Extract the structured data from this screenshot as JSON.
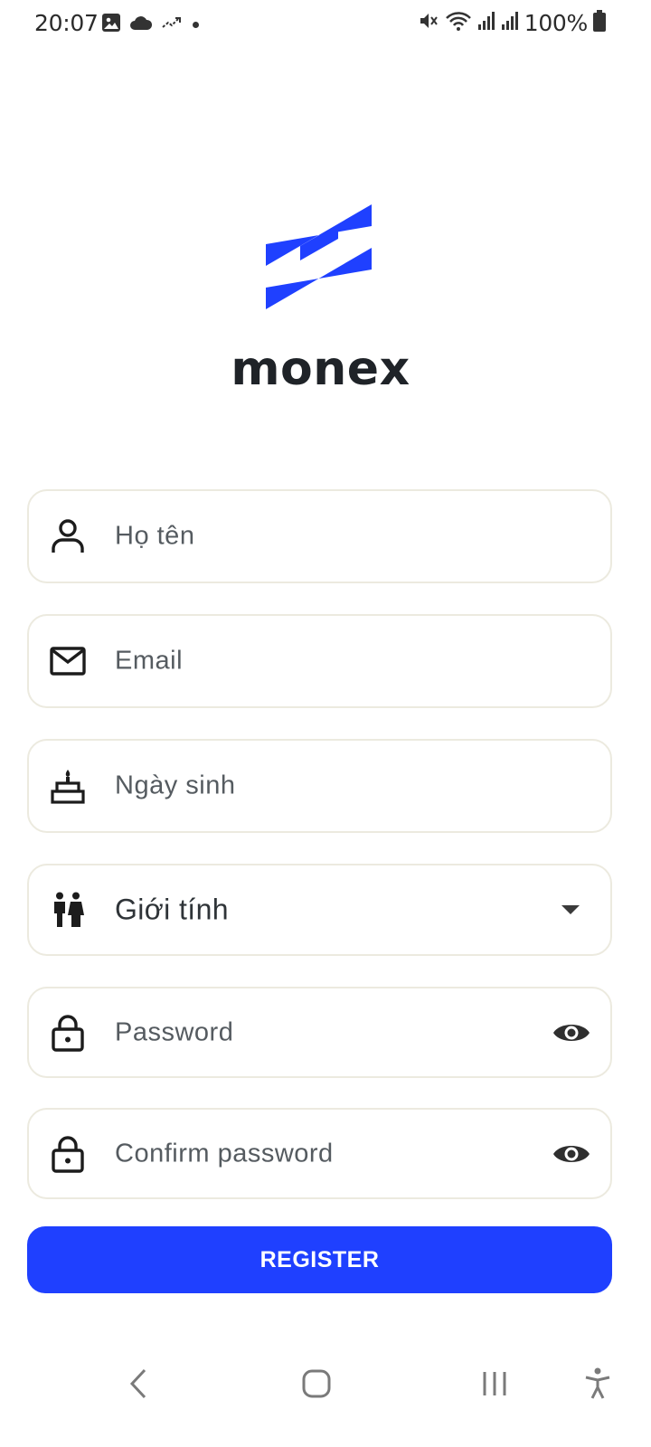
{
  "status_bar": {
    "time": "20:07",
    "battery": "100%",
    "left_icons": [
      "image-icon",
      "cloud-icon",
      "missed-call-icon",
      "dot-icon"
    ],
    "right_icons": [
      "mute-icon",
      "wifi-icon",
      "signal-icon",
      "signal-icon",
      "battery-icon"
    ]
  },
  "brand": {
    "name": "monex",
    "accent_color": "#1f40ff",
    "text_color": "#1f2328"
  },
  "form": {
    "fields": [
      {
        "placeholder": "Họ tên",
        "icon": "person-icon",
        "type": "text"
      },
      {
        "placeholder": "Email",
        "icon": "mail-icon",
        "type": "email"
      },
      {
        "placeholder": "Ngày sinh",
        "icon": "cake-icon",
        "type": "text"
      },
      {
        "placeholder": "Password",
        "icon": "lock-icon",
        "type": "password",
        "toggle_icon": "eye-icon"
      },
      {
        "placeholder": "Confirm password",
        "icon": "lock-icon",
        "type": "password",
        "toggle_icon": "eye-icon"
      }
    ],
    "gender": {
      "value": "Giới tính",
      "icon": "people-icon",
      "arrow_icon": "dropdown-arrow-icon"
    },
    "register_label": "REGISTER"
  },
  "nav_bar": {
    "buttons": [
      "back-icon",
      "home-icon",
      "recents-icon",
      "accessibility-icon"
    ]
  }
}
